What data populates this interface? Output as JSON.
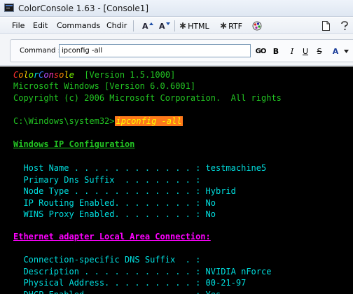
{
  "window": {
    "title": "ColorConsole 1.63  -  [Console1]"
  },
  "menu": {
    "items": [
      "File",
      "Edit",
      "Commands",
      "Chdir"
    ],
    "html_label": "HTML",
    "rtf_label": "RTF",
    "font_increase": "A",
    "font_decrease": "A"
  },
  "command": {
    "label": "Command :",
    "value": "ipconfig -all",
    "go_label": "GO",
    "bold_label": "B",
    "italic_label": "I",
    "underline_label": "U",
    "strike_label": "S",
    "color_label": "A"
  },
  "console": {
    "brand_letters": [
      "C",
      "o",
      "l",
      "o",
      "r",
      "C",
      "o",
      "n",
      "s",
      "o",
      "l",
      "e"
    ],
    "brand_colors": [
      "#ff3030",
      "#ff8c00",
      "#ffd700",
      "#7cfc00",
      "#00e5ee",
      "#3a7dff",
      "#b04dff",
      "#ff3cbe",
      "#ff3030",
      "#ff8c00",
      "#ffd700",
      "#7cfc00"
    ],
    "version": "  [Version 1.5.1000]",
    "os_line": "Microsoft Windows [Version 6.0.6001]",
    "copyright": "Copyright (c) 2006 Microsoft Corporation.  All rights",
    "prompt": "C:\\Windows\\system32>",
    "typed_command": "ipconfig -all",
    "section1": "Windows IP Configuration",
    "s1": [
      "  Host Name . . . . . . . . . . . . : testmachine5",
      "  Primary Dns Suffix  . . . . . . . :",
      "  Node Type . . . . . . . . . . . . : Hybrid",
      "  IP Routing Enabled. . . . . . . . : No",
      "  WINS Proxy Enabled. . . . . . . . : No"
    ],
    "section2": "Ethernet adapter Local Area Connection:",
    "s2": [
      "  Connection-specific DNS Suffix  . :",
      "  Description . . . . . . . . . . . : NVIDIA nForce",
      "  Physical Address. . . . . . . . . : 00-21-97",
      "  DHCP Enabled. . . . . . . . . . . : Yes"
    ],
    "colors": {
      "text": "#22c322",
      "prompt": "#22c322",
      "command_bg": "#ff7a1a",
      "command_fg": "#ffff00",
      "section1": "#22c322",
      "section2": "#ff00ff",
      "output": "#00dede"
    }
  }
}
